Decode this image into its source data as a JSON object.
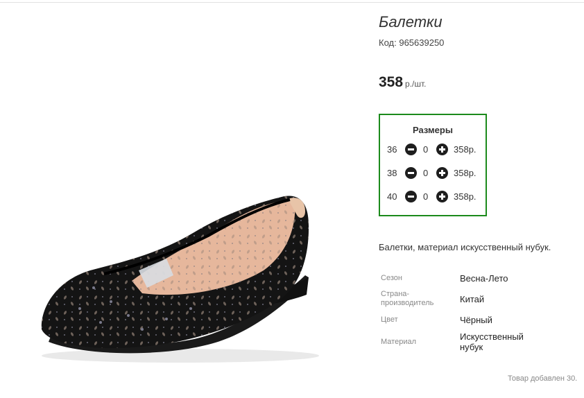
{
  "product": {
    "title": "Балетки",
    "code_label": "Код:",
    "code_value": "965639250",
    "price_value": "358",
    "price_unit": "р./шт.",
    "image_icon": "ballet-flat-shoe-image"
  },
  "sizes": {
    "heading": "Размеры",
    "rows": [
      {
        "size": "36",
        "qty": "0",
        "price": "358р."
      },
      {
        "size": "38",
        "qty": "0",
        "price": "358р."
      },
      {
        "size": "40",
        "qty": "0",
        "price": "358р."
      }
    ],
    "accent_color": "#1b8a1b"
  },
  "description": "Балетки, материал искусственный нубук.",
  "attributes": [
    {
      "label": "Сезон",
      "value": "Весна-Лето"
    },
    {
      "label": "Страна-\nпроизводитель",
      "value": "Китай"
    },
    {
      "label": "Цвет",
      "value": "Чёрный"
    },
    {
      "label": "Материал",
      "value": "Искусственный\nнубук"
    }
  ],
  "added_note": "Товар добавлен 30."
}
